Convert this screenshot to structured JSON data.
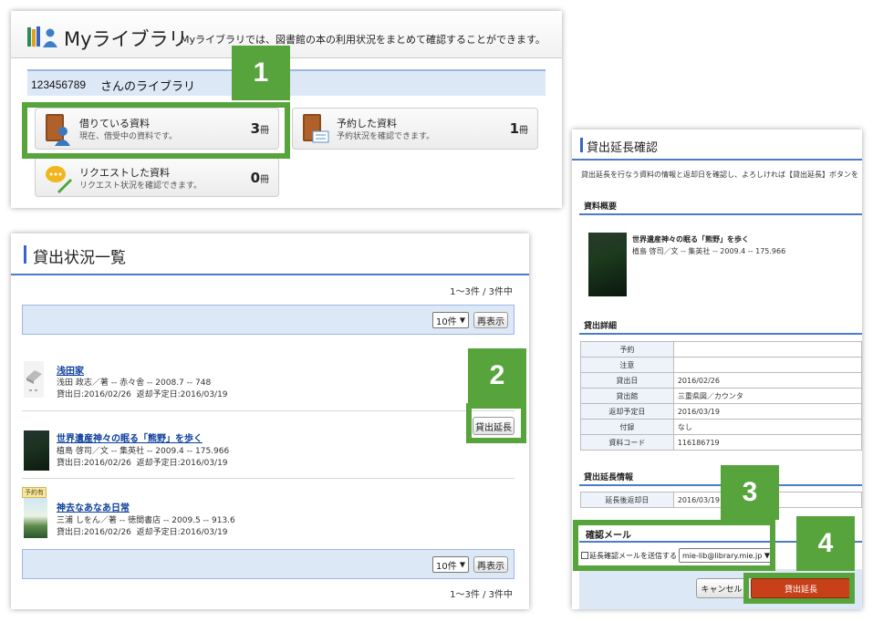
{
  "mylib": {
    "title": "Myライブラリ",
    "description": "Myライブラリでは、図書館の本の利用状況をまとめて確認することができます。",
    "user_id": "123456789",
    "user_suffix": "さんのライブラリ",
    "tiles": [
      {
        "title": "借りている資料",
        "sub": "現在、借受中の資料です。",
        "count": "3",
        "unit": "冊"
      },
      {
        "title": "予約した資料",
        "sub": "予約状況を確認できます。",
        "count": "1",
        "unit": "冊"
      },
      {
        "title": "リクエストした資料",
        "sub": "リクエスト状況を確認できます。",
        "count": "0",
        "unit": "冊"
      }
    ]
  },
  "loans": {
    "title": "貸出状況一覧",
    "range_top": "1～3件 / 3件中",
    "range_bottom": "1～3件 / 3件中",
    "per_page": "10件",
    "redisplay": "再表示",
    "extend_button": "貸出延長",
    "items": [
      {
        "title": "浅田家",
        "meta": "浅田 政志／著 -- 赤々舎 -- 2008.7 -- 748",
        "dates": "貸出日:2016/02/26  返却予定日:2016/03/19",
        "badge": ""
      },
      {
        "title": "世界遺産神々の眠る「熊野」を歩く",
        "meta": "植島 啓司／文 -- 集英社 -- 2009.4 -- 175.966",
        "dates": "貸出日:2016/02/26  返却予定日:2016/03/19",
        "badge": ""
      },
      {
        "title": "神去なあなあ日常",
        "meta": "三浦 しをん／著 -- 徳間書店 -- 2009.5 -- 913.6",
        "dates": "貸出日:2016/02/26  返却予定日:2016/03/19",
        "badge": "予約有"
      }
    ]
  },
  "confirm": {
    "title": "貸出延長確認",
    "intro": "貸出延長を行なう資料の情報と返却日を確認し、よろしければ【貸出延長】ボタンを",
    "summary_heading": "資料概要",
    "book_title": "世界遺産神々の眠る「熊野」を歩く",
    "book_meta": "植島 啓司／文 -- 集英社 -- 2009.4 -- 175.966",
    "detail_heading": "貸出詳細",
    "details": [
      {
        "k": "予約",
        "v": ""
      },
      {
        "k": "注意",
        "v": ""
      },
      {
        "k": "貸出日",
        "v": "2016/02/26"
      },
      {
        "k": "貸出館",
        "v": "三重県図／カウンタ"
      },
      {
        "k": "返却予定日",
        "v": "2016/03/19"
      },
      {
        "k": "付録",
        "v": "なし"
      },
      {
        "k": "資料コード",
        "v": "116186719"
      }
    ],
    "extend_heading": "貸出延長情報",
    "extend_row": {
      "k": "延長後返却日",
      "v": "2016/03/19"
    },
    "mail_heading": "確認メール",
    "mail_label": "延長確認メールを送信する",
    "mail_value": "mie-lib@library.mie.jp",
    "cancel": "キャンセル",
    "submit": "貸出延長"
  },
  "steps": [
    "1",
    "2",
    "3",
    "4"
  ],
  "colors": {
    "accent_green": "#56a43b",
    "header_blue": "#4a7cc8",
    "submit_red": "#c8401a"
  }
}
